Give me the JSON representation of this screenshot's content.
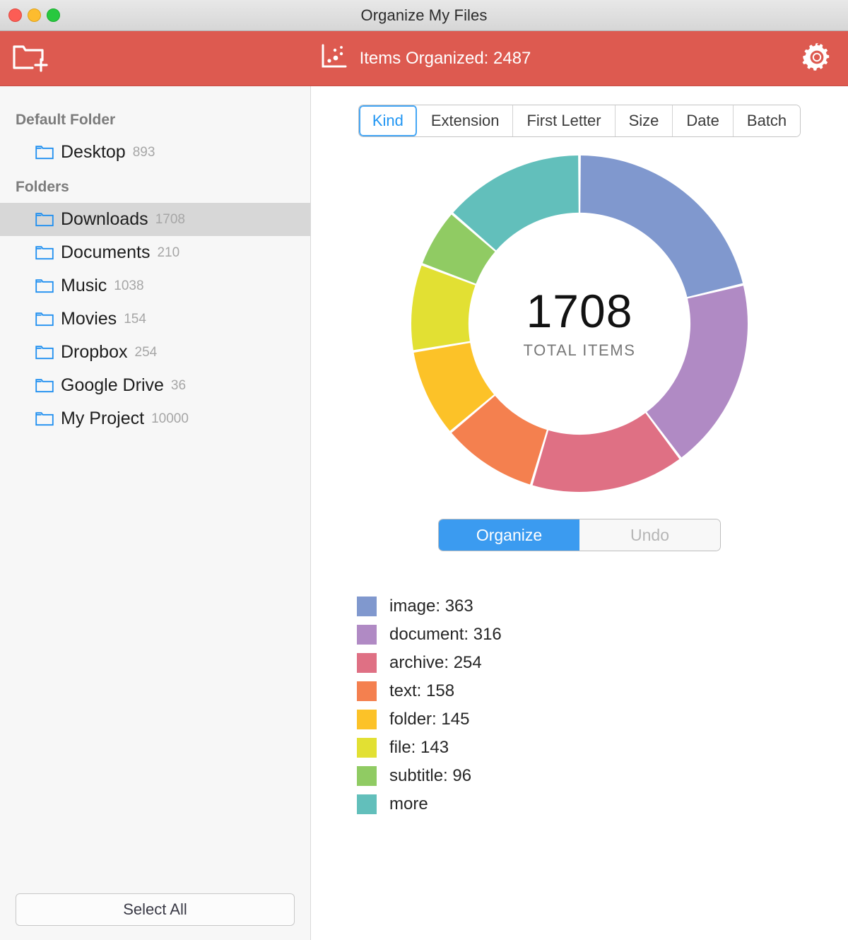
{
  "window": {
    "title": "Organize My Files",
    "traffic_lights": [
      "close",
      "minimize",
      "zoom"
    ]
  },
  "toolbar": {
    "add_folder_icon": "folder-plus-icon",
    "stats_icon": "scatter-chart-icon",
    "stats_label": "Items Organized: 2487",
    "settings_icon": "gear-icon",
    "background_color": "#dd5a50"
  },
  "sidebar": {
    "sections": [
      {
        "header": "Default Folder",
        "items": [
          {
            "name": "Desktop",
            "count": "893",
            "selected": false
          }
        ]
      },
      {
        "header": "Folders",
        "items": [
          {
            "name": "Downloads",
            "count": "1708",
            "selected": true
          },
          {
            "name": "Documents",
            "count": "210",
            "selected": false
          },
          {
            "name": "Music",
            "count": "1038",
            "selected": false
          },
          {
            "name": "Movies",
            "count": "154",
            "selected": false
          },
          {
            "name": "Dropbox",
            "count": "254",
            "selected": false
          },
          {
            "name": "Google Drive",
            "count": "36",
            "selected": false
          },
          {
            "name": "My Project",
            "count": "10000",
            "selected": false
          }
        ]
      }
    ],
    "select_all_label": "Select All",
    "folder_icon_color": "#1f8ff0"
  },
  "main": {
    "tabs": [
      {
        "label": "Kind",
        "active": true
      },
      {
        "label": "Extension",
        "active": false
      },
      {
        "label": "First Letter",
        "active": false
      },
      {
        "label": "Size",
        "active": false
      },
      {
        "label": "Date",
        "active": false
      },
      {
        "label": "Batch",
        "active": false
      }
    ],
    "organize_label": "Organize",
    "undo_label": "Undo",
    "undo_disabled": true,
    "accent_color": "#3b9bf0"
  },
  "chart_data": {
    "type": "pie",
    "title": "",
    "center_value": "1708",
    "center_label": "TOTAL ITEMS",
    "total": 1708,
    "start_angle": 0,
    "direction": "clockwise",
    "inner_radius_ratio": 0.66,
    "legend_position": "below",
    "categories": [
      "image",
      "document",
      "archive",
      "text",
      "folder",
      "file",
      "subtitle",
      "more"
    ],
    "values": [
      363,
      316,
      254,
      158,
      145,
      143,
      96,
      233
    ],
    "colors": [
      "#8098ce",
      "#b08ac4",
      "#df7084",
      "#f4804f",
      "#fcc228",
      "#e2e033",
      "#90cb63",
      "#62bfbb"
    ],
    "legend": [
      {
        "label": "image: 363",
        "color": "#8098ce"
      },
      {
        "label": "document: 316",
        "color": "#b08ac4"
      },
      {
        "label": "archive: 254",
        "color": "#df7084"
      },
      {
        "label": "text: 158",
        "color": "#f4804f"
      },
      {
        "label": "folder: 145",
        "color": "#fcc228"
      },
      {
        "label": "file: 143",
        "color": "#e2e033"
      },
      {
        "label": "subtitle: 96",
        "color": "#90cb63"
      },
      {
        "label": "more",
        "color": "#62bfbb"
      }
    ]
  }
}
